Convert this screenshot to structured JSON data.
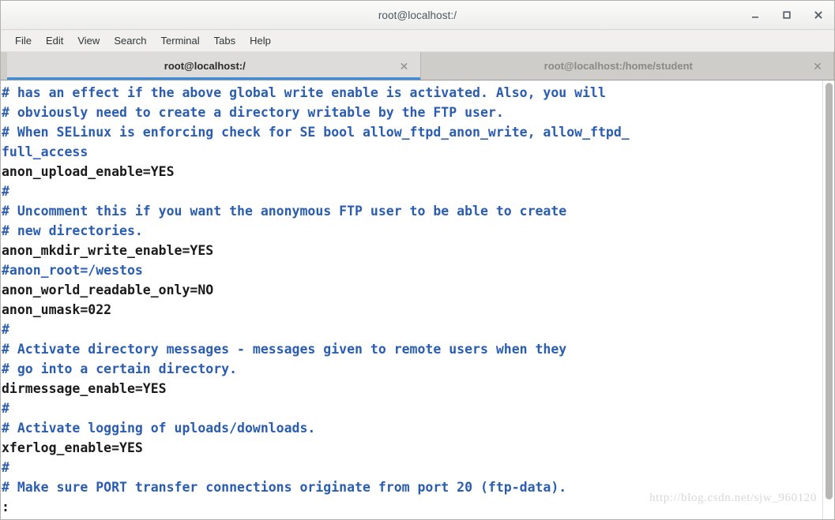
{
  "window": {
    "title": "root@localhost:/",
    "controls": [
      {
        "name": "minimize-button",
        "label": "_"
      },
      {
        "name": "maximize-button",
        "label": "□"
      },
      {
        "name": "close-button",
        "label": "✕"
      }
    ]
  },
  "menubar": {
    "items": [
      {
        "label": "File"
      },
      {
        "label": "Edit"
      },
      {
        "label": "View"
      },
      {
        "label": "Search"
      },
      {
        "label": "Terminal"
      },
      {
        "label": "Tabs"
      },
      {
        "label": "Help"
      }
    ]
  },
  "tabs": [
    {
      "label": "root@localhost:/",
      "active": true,
      "close_label": "✕"
    },
    {
      "label": "root@localhost:/home/student",
      "active": false,
      "close_label": "✕"
    }
  ],
  "terminal": {
    "colors": {
      "comment": "#2a5db0",
      "text": "#1a1a1a",
      "background": "#ffffff",
      "accent": "#3b8ddd"
    },
    "lines": [
      {
        "text": "# has an effect if the above global write enable is activated. Also, you will",
        "kind": "comment"
      },
      {
        "text": "# obviously need to create a directory writable by the FTP user.",
        "kind": "comment"
      },
      {
        "text": "# When SELinux is enforcing check for SE bool allow_ftpd_anon_write, allow_ftpd_",
        "kind": "comment"
      },
      {
        "text": "full_access",
        "kind": "comment"
      },
      {
        "text": "anon_upload_enable=YES",
        "kind": "plain"
      },
      {
        "text": "#",
        "kind": "comment"
      },
      {
        "text": "# Uncomment this if you want the anonymous FTP user to be able to create",
        "kind": "comment"
      },
      {
        "text": "# new directories.",
        "kind": "comment"
      },
      {
        "text": "anon_mkdir_write_enable=YES",
        "kind": "plain"
      },
      {
        "text": "#anon_root=/westos",
        "kind": "comment"
      },
      {
        "text": "anon_world_readable_only=NO",
        "kind": "plain"
      },
      {
        "text": "anon_umask=022",
        "kind": "plain"
      },
      {
        "text": "#",
        "kind": "comment"
      },
      {
        "text": "# Activate directory messages - messages given to remote users when they",
        "kind": "comment"
      },
      {
        "text": "# go into a certain directory.",
        "kind": "comment"
      },
      {
        "text": "dirmessage_enable=YES",
        "kind": "plain"
      },
      {
        "text": "#",
        "kind": "comment"
      },
      {
        "text": "# Activate logging of uploads/downloads.",
        "kind": "comment"
      },
      {
        "text": "xferlog_enable=YES",
        "kind": "plain"
      },
      {
        "text": "#",
        "kind": "comment"
      },
      {
        "text": "# Make sure PORT transfer connections originate from port 20 (ftp-data).",
        "kind": "comment"
      },
      {
        "text": ":",
        "kind": "plain"
      }
    ]
  },
  "watermark": {
    "text": "http://blog.csdn.net/sjw_960120"
  }
}
